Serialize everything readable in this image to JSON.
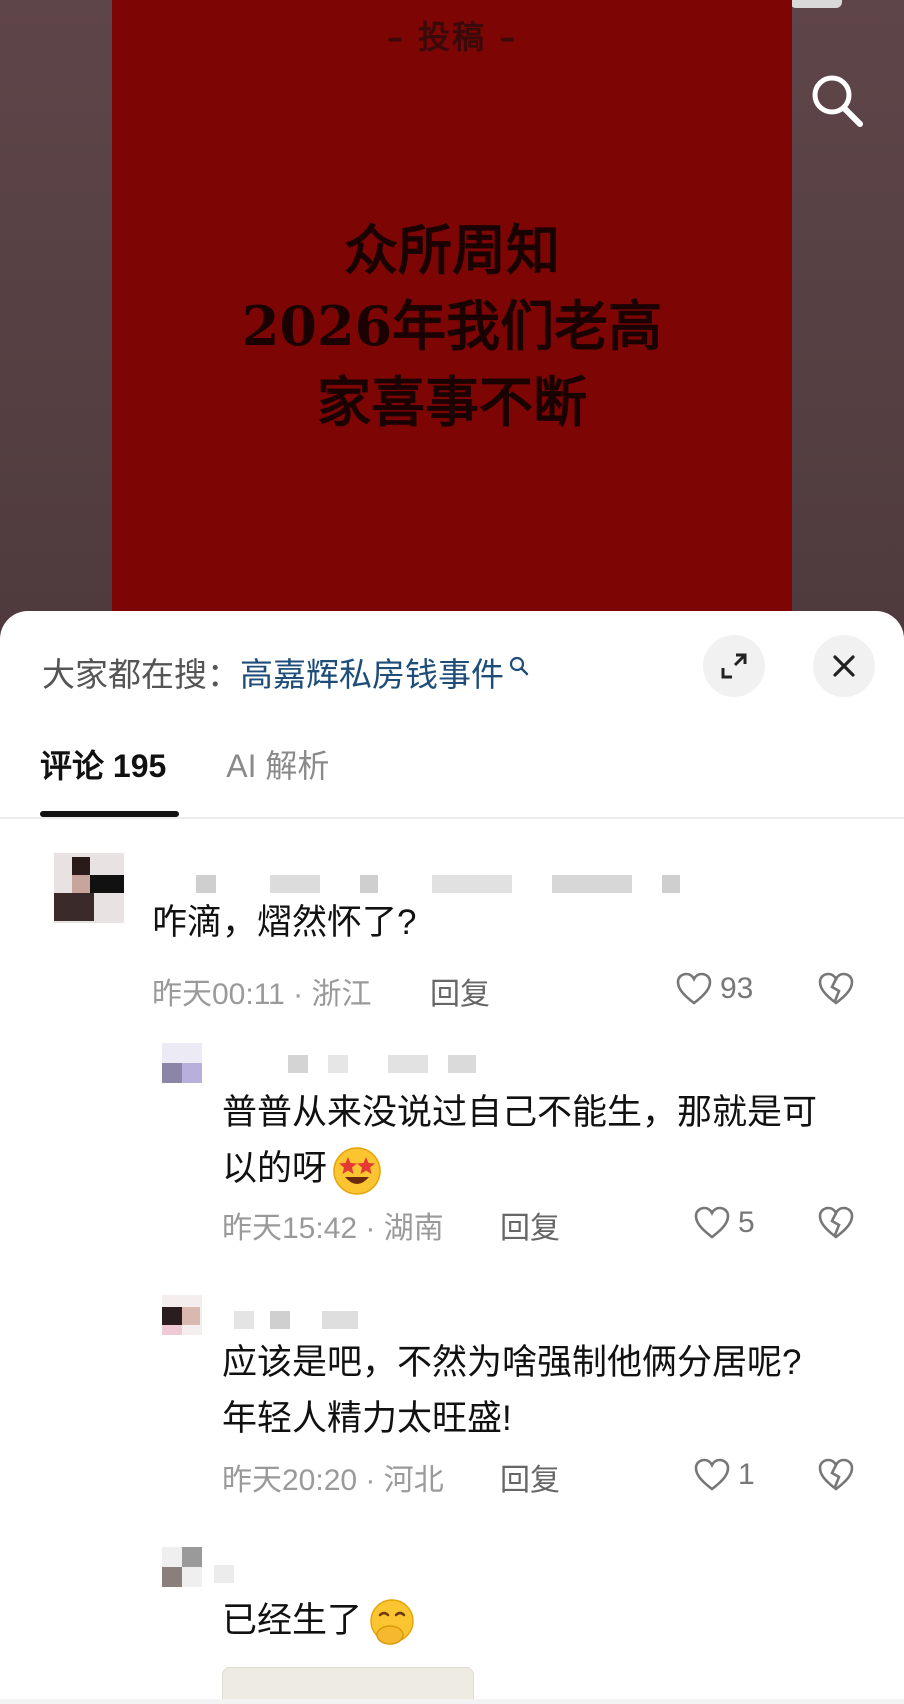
{
  "poster": {
    "top_label": "– 投稿 –",
    "lines": [
      "众所周知",
      "2026年我们老高",
      "家喜事不断"
    ],
    "colors": {
      "poster_bg": "#7d0504",
      "text": "#1b0202"
    }
  },
  "search_button_icon": "search-icon",
  "hot_search": {
    "prefix": "大家都在搜：",
    "keyword": "高嘉辉私房钱事件",
    "keyword_color": "#1f4d7a"
  },
  "sheet_buttons": {
    "expand_icon": "expand-icon",
    "close_icon": "close-icon"
  },
  "tabs": [
    {
      "label": "评论 195",
      "active": true
    },
    {
      "label": "AI 解析",
      "active": false
    }
  ],
  "comments": [
    {
      "text": "咋滴，熠然怀了?",
      "meta": "昨天00:11 · 浙江",
      "reply_label": "回复",
      "likes": "93"
    },
    {
      "text_line1": "普普从来没说过自己不能生，那就是可",
      "text_line2": "以的呀",
      "emoji": "star-struck-emoji",
      "meta": "昨天15:42 · 湖南",
      "reply_label": "回复",
      "likes": "5"
    },
    {
      "text_line1": "应该是吧，不然为啥强制他俩分居呢?",
      "text_line2": "年轻人精力太旺盛!",
      "meta": "昨天20:20 · 河北",
      "reply_label": "回复",
      "likes": "1"
    },
    {
      "text": "已经生了",
      "emoji": "hand-over-mouth-emoji"
    }
  ]
}
